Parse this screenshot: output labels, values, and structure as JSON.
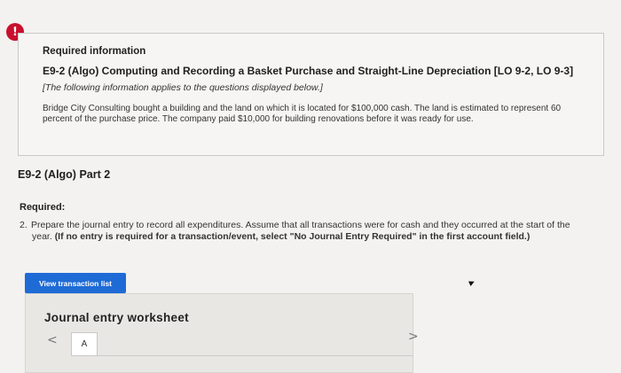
{
  "alert": {
    "icon": "exclamation-icon",
    "glyph": "!",
    "color": "#c8102e"
  },
  "info": {
    "heading": "Required information",
    "title": "E9-2 (Algo) Computing and Recording a Basket Purchase and Straight-Line Depreciation [LO 9-2, LO 9-3]",
    "note": "[The following information applies to the questions displayed below.]",
    "body": "Bridge City Consulting bought a building and the land on which it is located for $100,000 cash. The land is estimated to represent 60 percent of the purchase price. The company paid $10,000 for building renovations before it was ready for use."
  },
  "part": {
    "title": "E9-2 (Algo) Part 2"
  },
  "required": {
    "label": "Required:",
    "number": "2.",
    "text_line1": "Prepare the journal entry to record all expenditures. Assume that all transactions were for cash and they occurred at the start of the",
    "text_line2_plain": "year.",
    "text_line2_bold": "(If no entry is required for a transaction/event, select \"No Journal Entry Required\" in the first account field.)"
  },
  "buttons": {
    "view_transaction_list": "View transaction list",
    "color": "#1f6bd6"
  },
  "worksheet": {
    "title": "Journal entry worksheet",
    "prev_glyph": "<",
    "next_glyph": ">",
    "current_page": "A"
  }
}
